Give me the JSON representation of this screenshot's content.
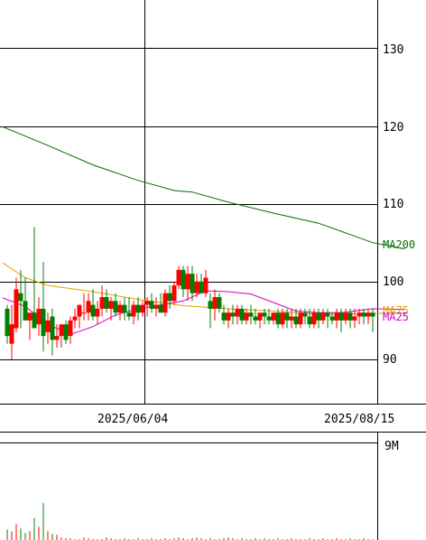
{
  "chart_data": [
    {
      "type": "candlestick",
      "y_ticks": [
        "130",
        "120",
        "110",
        "100",
        "90"
      ],
      "ylim": [
        84.3,
        136.2
      ],
      "x_ticks": [
        "2025/06/04",
        "2025/08/15"
      ],
      "grid": true,
      "legend_placement": "right",
      "ma_labels": {
        "ma200": "MA200",
        "ma75": "MA75",
        "ma25": "MA25"
      },
      "colors": {
        "up": "#ff0000",
        "down": "#008000",
        "ma200": "#007000",
        "ma75": "#e8a000",
        "ma25": "#d000c0",
        "grid": "#000000",
        "text": "#000000"
      },
      "candles": [
        [
          1,
          96.5,
          97.0,
          92.0,
          93.0
        ],
        [
          2,
          92.0,
          97.0,
          90.0,
          94.5
        ],
        [
          3,
          94.0,
          100.5,
          93.5,
          99.0
        ],
        [
          4,
          98.5,
          101.5,
          94.0,
          97.5
        ],
        [
          5,
          97.5,
          100.5,
          96.0,
          95.0
        ],
        [
          6,
          95.0,
          95.5,
          92.5,
          96.0
        ],
        [
          7,
          96.0,
          107.0,
          95.0,
          94.0
        ],
        [
          8,
          94.5,
          98.0,
          93.0,
          96.5
        ],
        [
          9,
          96.5,
          102.5,
          91.0,
          93.0
        ],
        [
          10,
          93.5,
          96.0,
          92.0,
          95.0
        ],
        [
          11,
          95.5,
          96.5,
          90.5,
          92.5
        ],
        [
          12,
          92.5,
          94.5,
          91.5,
          93.0
        ],
        [
          13,
          93.0,
          94.0,
          91.5,
          94.5
        ],
        [
          14,
          94.5,
          95.0,
          92.0,
          92.5
        ],
        [
          15,
          93.0,
          95.5,
          92.0,
          95.0
        ],
        [
          16,
          95.0,
          96.5,
          94.0,
          95.5
        ],
        [
          17,
          95.5,
          97.0,
          94.0,
          97.0
        ],
        [
          18,
          96.0,
          98.5,
          95.0,
          96.0
        ],
        [
          19,
          96.0,
          98.5,
          95.0,
          97.5
        ],
        [
          20,
          97.0,
          99.0,
          95.0,
          95.5
        ],
        [
          21,
          95.5,
          97.5,
          94.5,
          96.5
        ],
        [
          22,
          96.5,
          99.5,
          95.5,
          98.0
        ],
        [
          23,
          98.0,
          99.0,
          96.0,
          96.5
        ],
        [
          24,
          96.5,
          98.0,
          95.0,
          97.5
        ],
        [
          25,
          97.5,
          98.5,
          95.5,
          96.0
        ],
        [
          26,
          96.0,
          97.5,
          95.0,
          97.0
        ],
        [
          27,
          97.0,
          98.0,
          95.0,
          96.0
        ],
        [
          28,
          96.0,
          98.0,
          95.0,
          95.5
        ],
        [
          29,
          95.5,
          97.5,
          94.5,
          97.0
        ],
        [
          30,
          97.0,
          98.0,
          95.0,
          96.0
        ],
        [
          31,
          96.0,
          97.5,
          95.5,
          97.0
        ],
        [
          32,
          97.0,
          98.0,
          95.5,
          97.5
        ],
        [
          33,
          97.5,
          98.5,
          96.0,
          96.5
        ],
        [
          34,
          96.5,
          98.0,
          95.5,
          97.0
        ],
        [
          35,
          97.0,
          98.5,
          96.0,
          96.0
        ],
        [
          36,
          96.0,
          99.0,
          95.5,
          98.5
        ],
        [
          37,
          98.5,
          99.5,
          96.5,
          97.5
        ],
        [
          38,
          97.5,
          100.0,
          97.0,
          99.5
        ],
        [
          39,
          99.5,
          102.0,
          99.0,
          101.5
        ],
        [
          40,
          101.5,
          102.0,
          98.0,
          99.0
        ],
        [
          41,
          99.0,
          102.0,
          97.5,
          101.0
        ],
        [
          42,
          101.0,
          102.0,
          97.5,
          98.5
        ],
        [
          43,
          98.5,
          101.0,
          98.0,
          100.0
        ],
        [
          44,
          100.0,
          101.0,
          98.5,
          98.5
        ],
        [
          45,
          98.5,
          101.5,
          98.0,
          100.5
        ],
        [
          46,
          97.5,
          98.5,
          94.0,
          96.5
        ],
        [
          47,
          96.5,
          99.0,
          95.0,
          98.0
        ],
        [
          48,
          98.0,
          98.5,
          96.0,
          96.5
        ],
        [
          49,
          96.0,
          97.0,
          94.5,
          95.0
        ],
        [
          50,
          95.0,
          96.5,
          94.0,
          96.0
        ],
        [
          51,
          96.0,
          97.0,
          94.5,
          95.5
        ],
        [
          52,
          95.5,
          97.0,
          94.5,
          96.5
        ],
        [
          53,
          96.5,
          97.0,
          94.5,
          95.0
        ],
        [
          54,
          95.0,
          96.5,
          94.5,
          96.0
        ],
        [
          55,
          96.0,
          97.0,
          94.5,
          95.5
        ],
        [
          56,
          95.5,
          96.5,
          94.5,
          95.0
        ],
        [
          57,
          95.0,
          96.0,
          94.0,
          96.0
        ],
        [
          58,
          96.0,
          96.5,
          94.5,
          95.5
        ],
        [
          59,
          95.5,
          96.5,
          94.5,
          95.0
        ],
        [
          60,
          95.0,
          96.0,
          94.5,
          96.0
        ],
        [
          61,
          96.0,
          96.5,
          94.0,
          94.5
        ],
        [
          62,
          94.5,
          96.5,
          94.0,
          96.0
        ],
        [
          63,
          96.0,
          96.5,
          94.0,
          95.0
        ],
        [
          64,
          95.0,
          96.5,
          94.0,
          95.5
        ],
        [
          65,
          95.5,
          96.5,
          94.0,
          94.5
        ],
        [
          66,
          94.5,
          96.5,
          94.0,
          96.0
        ],
        [
          67,
          96.0,
          96.5,
          94.5,
          95.5
        ],
        [
          68,
          95.5,
          96.5,
          94.0,
          94.5
        ],
        [
          69,
          94.5,
          96.5,
          94.0,
          96.0
        ],
        [
          70,
          96.0,
          96.5,
          94.0,
          95.0
        ],
        [
          71,
          95.0,
          96.5,
          94.5,
          96.0
        ],
        [
          72,
          96.0,
          96.5,
          94.0,
          95.5
        ],
        [
          73,
          95.5,
          96.0,
          94.5,
          95.0
        ],
        [
          74,
          95.0,
          96.5,
          94.0,
          96.0
        ],
        [
          75,
          96.0,
          96.5,
          93.5,
          95.0
        ],
        [
          76,
          95.0,
          96.5,
          94.5,
          96.0
        ],
        [
          77,
          96.0,
          96.5,
          94.0,
          95.0
        ],
        [
          78,
          95.0,
          96.5,
          94.0,
          95.5
        ],
        [
          79,
          95.5,
          96.5,
          94.5,
          96.0
        ],
        [
          80,
          96.0,
          96.5,
          94.5,
          95.5
        ],
        [
          81,
          95.5,
          96.5,
          94.5,
          96.0
        ],
        [
          82,
          96.0,
          96.5,
          93.5,
          95.5
        ]
      ],
      "ma200": [
        [
          0,
          119.9
        ],
        [
          10,
          117.5
        ],
        [
          20,
          115.0
        ],
        [
          30,
          113.0
        ],
        [
          38,
          111.7
        ],
        [
          42,
          111.5
        ],
        [
          50,
          110.2
        ],
        [
          60,
          108.8
        ],
        [
          70,
          107.5
        ],
        [
          82,
          105.0
        ],
        [
          89,
          104.2
        ]
      ],
      "ma75": [
        [
          0,
          102.4
        ],
        [
          5,
          100.5
        ],
        [
          10,
          99.5
        ],
        [
          20,
          98.7
        ],
        [
          30,
          97.7
        ],
        [
          40,
          96.9
        ],
        [
          50,
          96.5
        ],
        [
          60,
          96.2
        ],
        [
          70,
          95.8
        ],
        [
          82,
          95.9
        ],
        [
          89,
          96.0
        ]
      ],
      "ma25": [
        [
          0,
          97.9
        ],
        [
          5,
          96.8
        ],
        [
          10,
          94.5
        ],
        [
          15,
          93.2
        ],
        [
          20,
          94.2
        ],
        [
          25,
          95.7
        ],
        [
          30,
          96.5
        ],
        [
          40,
          97.5
        ],
        [
          45,
          98.8
        ],
        [
          50,
          98.7
        ],
        [
          55,
          98.4
        ],
        [
          60,
          97.3
        ],
        [
          65,
          96.2
        ],
        [
          70,
          96.0
        ],
        [
          75,
          96.0
        ],
        [
          82,
          96.5
        ],
        [
          89,
          96.4
        ]
      ]
    },
    {
      "type": "bar",
      "y_ticks": [
        "9M"
      ],
      "ylim": [
        0,
        11
      ],
      "volume": [
        1.2,
        1.0,
        1.8,
        1.3,
        0.8,
        1.0,
        2.5,
        1.5,
        4.2,
        1.0,
        0.7,
        0.6,
        0.3,
        0.2,
        0.2,
        0.1,
        0.1,
        0.3,
        0.2,
        0.1,
        0.1,
        0.1,
        0.3,
        0.2,
        0.1,
        0.1,
        0.2,
        0.1,
        0.1,
        0.2,
        0.1,
        0.1,
        0.2,
        0.1,
        0.1,
        0.2,
        0.1,
        0.2,
        0.3,
        0.2,
        0.1,
        0.2,
        0.3,
        0.2,
        0.1,
        0.2,
        0.1,
        0.1,
        0.2,
        0.3,
        0.2,
        0.1,
        0.2,
        0.1,
        0.1,
        0.2,
        0.1,
        0.2,
        0.1,
        0.1,
        0.2,
        0.1,
        0.1,
        0.2,
        0.1,
        0.1,
        0.1,
        0.2,
        0.1,
        0.1,
        0.2,
        0.1,
        0.1,
        0.2,
        0.1,
        0.1,
        0.2,
        0.1,
        0.1,
        0.2,
        0.1,
        0.1
      ]
    }
  ]
}
